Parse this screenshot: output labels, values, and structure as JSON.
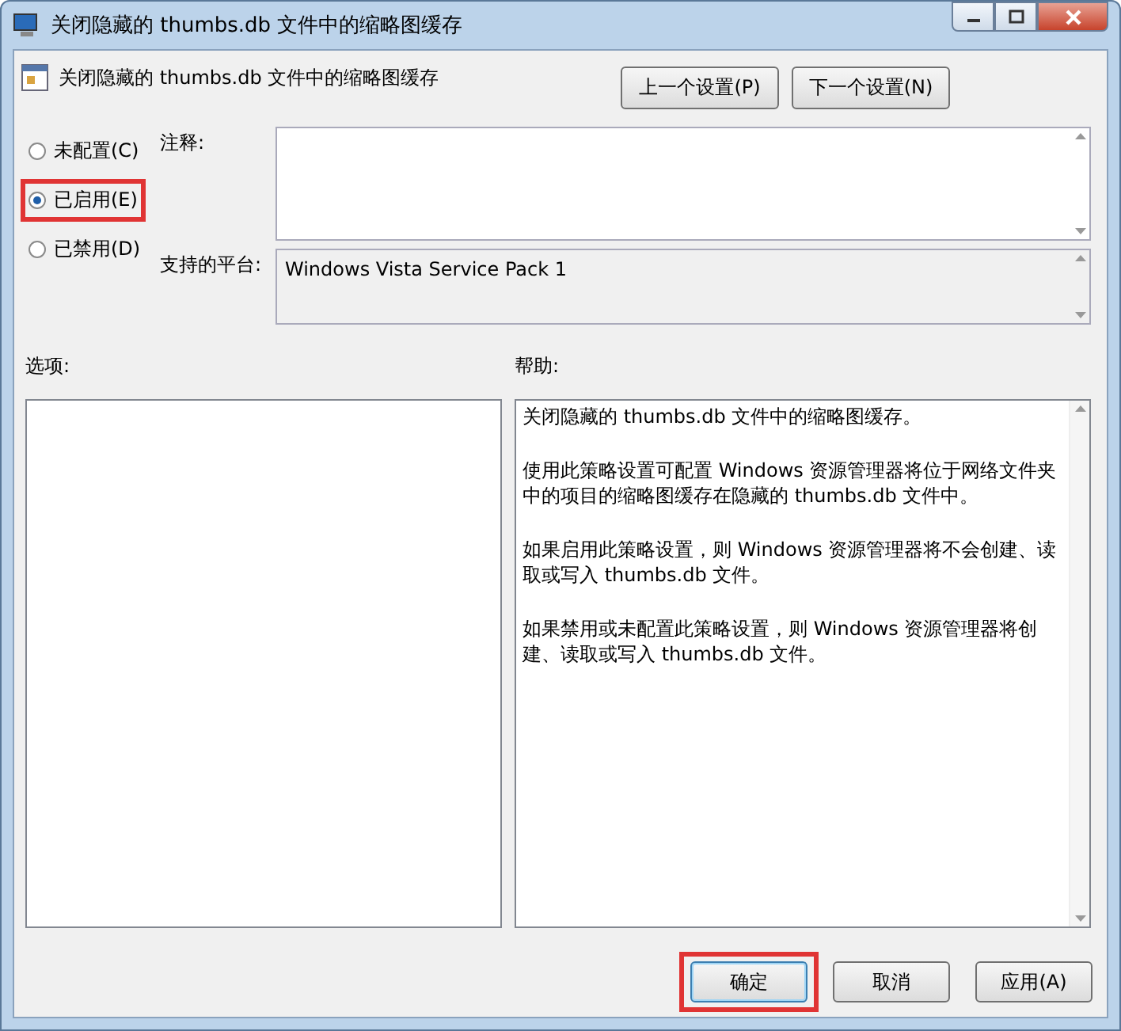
{
  "window": {
    "title": "关闭隐藏的 thumbs.db 文件中的缩略图缓存"
  },
  "policy": {
    "name": "关闭隐藏的 thumbs.db 文件中的缩略图缓存"
  },
  "nav_buttons": [
    {
      "label": "上一个设置(P)"
    },
    {
      "label": "下一个设置(N)"
    }
  ],
  "states": [
    {
      "label": "未配置(C)",
      "selected": false,
      "highlighted": false
    },
    {
      "label": "已启用(E)",
      "selected": true,
      "highlighted": true
    },
    {
      "label": "已禁用(D)",
      "selected": false,
      "highlighted": false
    }
  ],
  "comment": {
    "label": "注释:"
  },
  "platform": {
    "label": "支持的平台:",
    "value": "Windows Vista Service Pack 1"
  },
  "options": {
    "label": "选项:"
  },
  "help": {
    "label": "帮助:",
    "paragraphs": [
      "关闭隐藏的 thumbs.db 文件中的缩略图缓存。",
      "使用此策略设置可配置 Windows 资源管理器将位于网络文件夹中的项目的缩略图缓存在隐藏的 thumbs.db 文件中。",
      "如果启用此策略设置，则 Windows 资源管理器将不会创建、读取或写入 thumbs.db 文件。",
      "如果禁用或未配置此策略设置，则 Windows 资源管理器将创建、读取或写入 thumbs.db 文件。"
    ]
  },
  "buttons": [
    {
      "label": "确定",
      "highlighted": true
    },
    {
      "label": "取消",
      "highlighted": false
    },
    {
      "label": "应用(A)",
      "highlighted": false
    }
  ]
}
